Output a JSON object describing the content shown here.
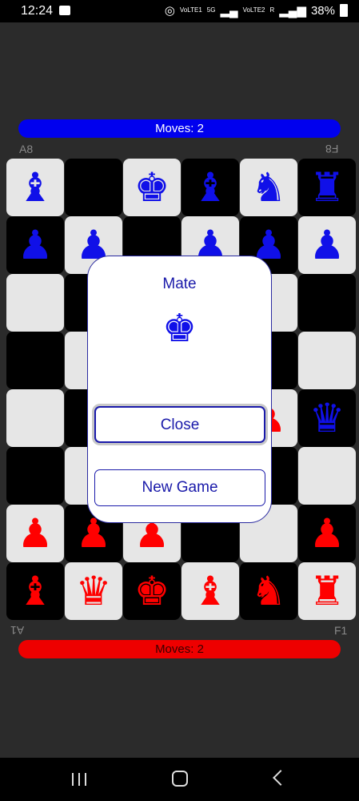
{
  "status": {
    "time": "12:24",
    "battery": "38%",
    "net1": "VoLTE1",
    "net2": "5G",
    "net3": "VoLTE2",
    "net4": "R"
  },
  "top_moves": "Moves: 2",
  "bottom_moves": "Moves: 2",
  "coords": {
    "a8": "A8",
    "f8": "F8",
    "a1": "A1",
    "f1": "F1"
  },
  "board": [
    [
      {
        "c": "blue",
        "p": "♝"
      },
      {
        "c": "",
        "p": ""
      },
      {
        "c": "blue",
        "p": "♚"
      },
      {
        "c": "blue",
        "p": "♝"
      },
      {
        "c": "blue",
        "p": "♞"
      },
      {
        "c": "blue",
        "p": "♜"
      }
    ],
    [
      {
        "c": "blue",
        "p": "♟"
      },
      {
        "c": "blue",
        "p": "♟"
      },
      {
        "c": "",
        "p": ""
      },
      {
        "c": "blue",
        "p": "♟"
      },
      {
        "c": "blue",
        "p": "♟"
      },
      {
        "c": "blue",
        "p": "♟"
      }
    ],
    [
      {
        "c": "",
        "p": ""
      },
      {
        "c": "",
        "p": ""
      },
      {
        "c": "",
        "p": ""
      },
      {
        "c": "",
        "p": ""
      },
      {
        "c": "",
        "p": ""
      },
      {
        "c": "",
        "p": ""
      }
    ],
    [
      {
        "c": "",
        "p": ""
      },
      {
        "c": "",
        "p": ""
      },
      {
        "c": "",
        "p": ""
      },
      {
        "c": "",
        "p": ""
      },
      {
        "c": "",
        "p": ""
      },
      {
        "c": "",
        "p": ""
      }
    ],
    [
      {
        "c": "",
        "p": ""
      },
      {
        "c": "",
        "p": ""
      },
      {
        "c": "",
        "p": ""
      },
      {
        "c": "",
        "p": ""
      },
      {
        "c": "red",
        "p": "♟"
      },
      {
        "c": "blue",
        "p": "♛"
      }
    ],
    [
      {
        "c": "",
        "p": ""
      },
      {
        "c": "",
        "p": ""
      },
      {
        "c": "",
        "p": ""
      },
      {
        "c": "",
        "p": ""
      },
      {
        "c": "",
        "p": ""
      },
      {
        "c": "",
        "p": ""
      }
    ],
    [
      {
        "c": "red",
        "p": "♟"
      },
      {
        "c": "red",
        "p": "♟"
      },
      {
        "c": "red",
        "p": "♟"
      },
      {
        "c": "",
        "p": ""
      },
      {
        "c": "",
        "p": ""
      },
      {
        "c": "red",
        "p": "♟"
      }
    ],
    [
      {
        "c": "red",
        "p": "♝"
      },
      {
        "c": "red",
        "p": "♛"
      },
      {
        "c": "red",
        "p": "♚"
      },
      {
        "c": "red",
        "p": "♝"
      },
      {
        "c": "red",
        "p": "♞"
      },
      {
        "c": "red",
        "p": "♜"
      }
    ]
  ],
  "dialog": {
    "title": "Mate",
    "icon": "♚",
    "close_label": "Close",
    "new_game_label": "New Game"
  }
}
